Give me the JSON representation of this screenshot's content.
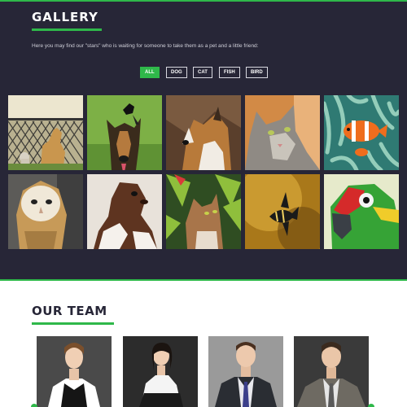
{
  "gallery": {
    "title": "GALLERY",
    "description": "Here you may find our \"stars\" who is waiting for someone to take them as a pet and a little friend:",
    "filters": [
      {
        "label": "ALL",
        "active": true
      },
      {
        "label": "DOG",
        "active": false
      },
      {
        "label": "CAT",
        "active": false
      },
      {
        "label": "FISH",
        "active": false
      },
      {
        "label": "BIRD",
        "active": false
      }
    ],
    "photos": [
      {
        "subject": "dog-behind-fence"
      },
      {
        "subject": "german-shepherd-with-bird"
      },
      {
        "subject": "collie"
      },
      {
        "subject": "grey-cat"
      },
      {
        "subject": "clownfish"
      },
      {
        "subject": "owl"
      },
      {
        "subject": "spaniel"
      },
      {
        "subject": "kitten-in-plants"
      },
      {
        "subject": "small-fish"
      },
      {
        "subject": "parrot"
      }
    ]
  },
  "team": {
    "title": "OUR TEAM",
    "members": [
      {
        "photo": "woman-black-vest"
      },
      {
        "photo": "woman-sitting"
      },
      {
        "photo": "man-suit"
      },
      {
        "photo": "man-grey-suit"
      }
    ]
  },
  "colors": {
    "accent": "#2fb84a",
    "gallery_background": "#272637",
    "page_background": "#ffffff"
  }
}
